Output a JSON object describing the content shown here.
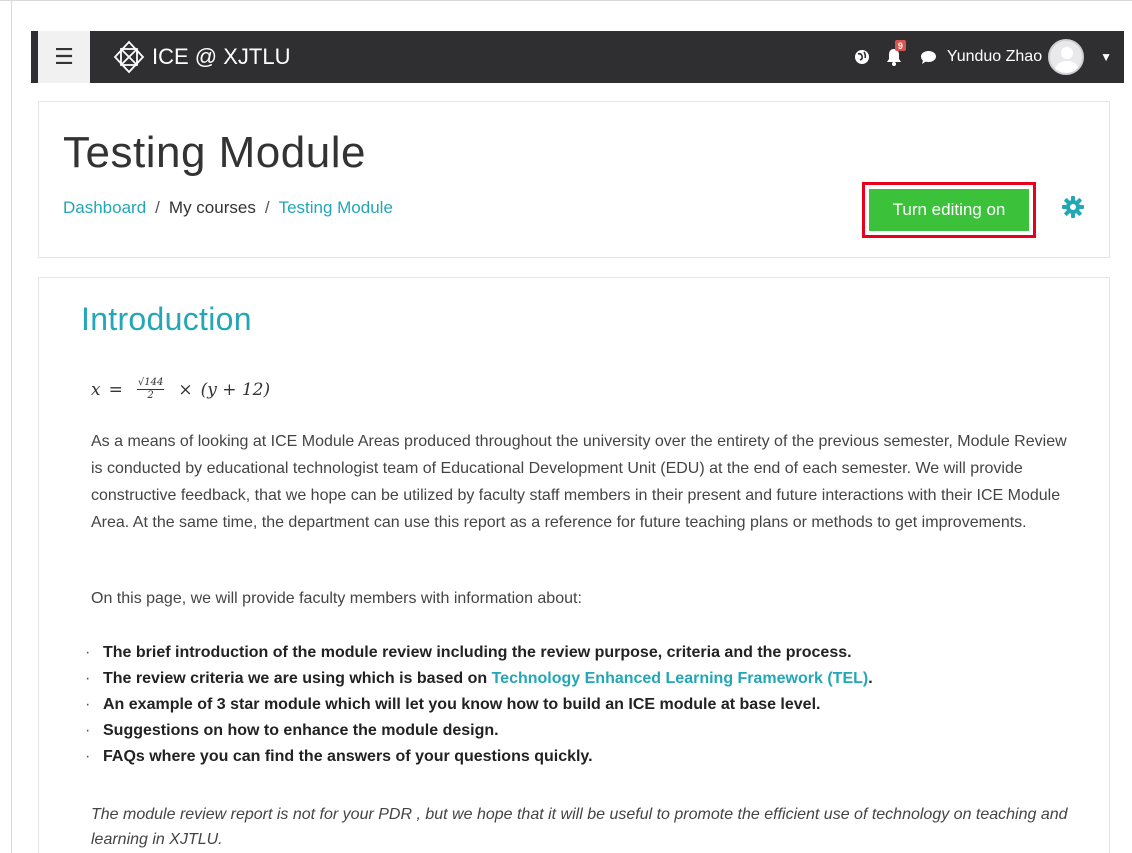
{
  "navbar": {
    "menu_icon": "hamburger-icon",
    "brand_logo": "ice-logo-icon",
    "brand_text": "ICE @ XJTLU",
    "language_icon": "globe-icon",
    "notifications_icon": "bell-icon",
    "notifications_count": "9",
    "messages_icon": "chat-icon",
    "user_name": "Yunduo Zhao",
    "user_menu_icon": "caret-down-icon"
  },
  "header": {
    "title": "Testing Module",
    "breadcrumb": {
      "dashboard": "Dashboard",
      "my_courses": "My courses",
      "current": "Testing Module",
      "separator": "/"
    },
    "edit_button": "Turn editing on",
    "settings_icon": "gear-icon"
  },
  "content": {
    "section_title": "Introduction",
    "formula": {
      "lhs": "x",
      "eq": "=",
      "numerator": "√144",
      "denominator": "2",
      "times": "×",
      "rhs": "(y + 12)"
    },
    "paragraph": "As a means of looking at ICE Module Areas produced throughout the university over the entirety of the previous semester, Module Review is conducted by educational technologist team of Educational Development Unit (EDU) at the end of each semester. We will provide constructive feedback, that we hope can be utilized by faculty staff members in their present and future interactions with their ICE Module Area. At the same time, the department can use this report as a reference for future teaching plans or methods to get improvements.",
    "intro_line": "On this page, we will provide faculty members with information about:",
    "bullets": [
      "The brief introduction of the module review including the review purpose, criteria and the process.",
      "The review criteria we are using which is based on ",
      "An example of 3 star module which will let you know how to build an ICE module at base level.",
      "Suggestions on how to enhance the module design.",
      "FAQs where you can find the answers of your questions quickly."
    ],
    "bullet2_link": "Technology Enhanced Learning Framework (TEL)",
    "bullet2_end": ".",
    "bullet_marker": "·",
    "footer_note": "The module review report is not for your PDR , but we hope that it will be useful to promote the efficient use of technology on teaching and learning in XJTLU."
  },
  "colors": {
    "navbar_bg": "#2f2f32",
    "accent": "#23a6b5",
    "edit_button": "#3cc13b",
    "highlight_box": "#e8001c"
  }
}
